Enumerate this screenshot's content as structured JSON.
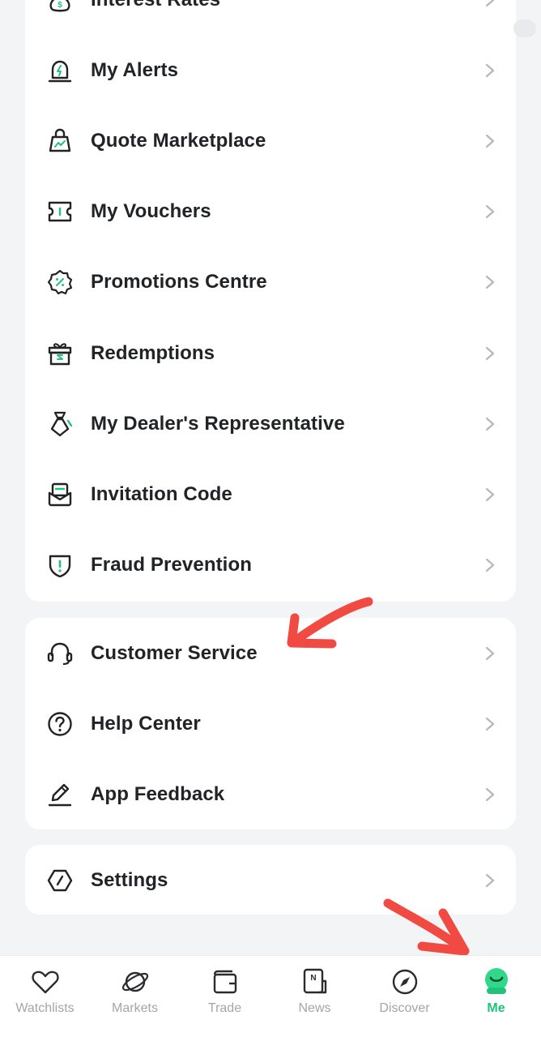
{
  "menu_main": [
    {
      "label": "Interest Rates",
      "icon": "moneybag-icon"
    },
    {
      "label": "My Alerts",
      "icon": "alarm-icon"
    },
    {
      "label": "Quote Marketplace",
      "icon": "shopping-bag-chart-icon"
    },
    {
      "label": "My Vouchers",
      "icon": "voucher-icon"
    },
    {
      "label": "Promotions Centre",
      "icon": "discount-badge-icon"
    },
    {
      "label": "Redemptions",
      "icon": "gift-icon"
    },
    {
      "label": "My Dealer's Representative",
      "icon": "representative-icon"
    },
    {
      "label": "Invitation Code",
      "icon": "envelope-icon"
    },
    {
      "label": "Fraud Prevention",
      "icon": "shield-alert-icon"
    }
  ],
  "menu_support": [
    {
      "label": "Customer Service",
      "icon": "headset-icon"
    },
    {
      "label": "Help Center",
      "icon": "question-circle-icon"
    },
    {
      "label": "App Feedback",
      "icon": "pencil-icon"
    }
  ],
  "menu_settings": [
    {
      "label": "Settings",
      "icon": "settings-hexagon-icon"
    }
  ],
  "tabs": [
    {
      "label": "Watchlists",
      "icon": "heart-icon",
      "active": false
    },
    {
      "label": "Markets",
      "icon": "planet-icon",
      "active": false
    },
    {
      "label": "Trade",
      "icon": "wallet-icon",
      "active": false
    },
    {
      "label": "News",
      "icon": "news-icon",
      "active": false
    },
    {
      "label": "Discover",
      "icon": "compass-icon",
      "active": false
    },
    {
      "label": "Me",
      "icon": "profile-avatar-icon",
      "active": true
    }
  ],
  "colors": {
    "accent": "#22c27a",
    "annotation_arrow": "#f04a43",
    "text": "#222327",
    "tab_inactive": "#a3a5ab",
    "background": "#f3f4f6"
  }
}
